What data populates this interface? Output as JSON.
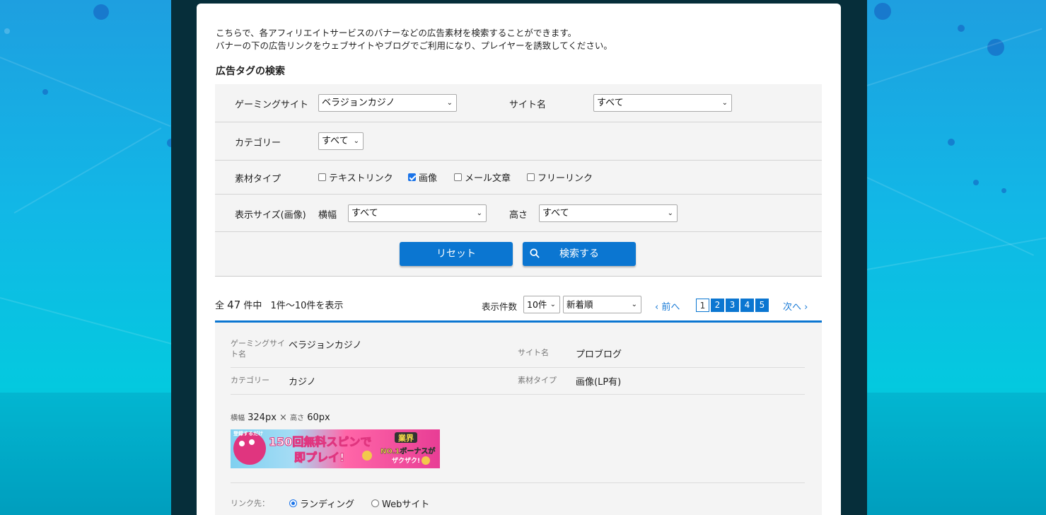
{
  "intro": {
    "line1": "こちらで、各アフィリエイトサービスのバナーなどの広告素材を検索することができます。",
    "line2": "バナーの下の広告リンクをウェブサイトやブログでご利用になり、プレイヤーを誘致してください。"
  },
  "search": {
    "title": "広告タグの検索",
    "gaming_site_label": "ゲーミングサイト",
    "gaming_site_value": "ベラジョンカジノ",
    "site_name_label": "サイト名",
    "site_name_value": "すべて",
    "category_label": "カテゴリー",
    "category_value": "すべて",
    "material_type_label": "素材タイプ",
    "material_types": [
      {
        "label": "テキストリンク",
        "checked": false
      },
      {
        "label": "画像",
        "checked": true
      },
      {
        "label": "メール文章",
        "checked": false
      },
      {
        "label": "フリーリンク",
        "checked": false
      }
    ],
    "display_size_label": "表示サイズ(画像)",
    "width_label": "横幅",
    "width_value": "すべて",
    "height_label": "高さ",
    "height_value": "すべて",
    "reset_label": "リセット",
    "search_label": "検索する"
  },
  "results": {
    "prefix": "全",
    "total": "47",
    "suffix": "件中",
    "range": "1件～10件を表示",
    "per_page_label": "表示件数",
    "per_page_value": "10件",
    "sort_value": "新着順",
    "prev_label": "前へ",
    "next_label": "次へ",
    "pages": [
      "1",
      "2",
      "3",
      "4",
      "5"
    ],
    "current_page": "1"
  },
  "item": {
    "gaming_site_label": "ゲーミングサイト名",
    "gaming_site_value": "ベラジョンカジノ",
    "site_name_label": "サイト名",
    "site_name_value": "プロブログ",
    "category_label": "カテゴリー",
    "category_value": "カジノ",
    "material_type_label": "素材タイプ",
    "material_type_value": "画像(LP有)",
    "width_label": "横幅",
    "width_value": "324px",
    "times": "×",
    "height_label": "高さ",
    "height_value": "60px",
    "banner": {
      "small_text": "登録するだけ",
      "main_text": "150回無料スピンで",
      "main_text2": "即プレイ!",
      "badge1": "業界",
      "badge2": "NO.1ボーナスが",
      "badge3": "ザクザク!"
    },
    "link_label": "リンク先：",
    "link_options": [
      {
        "label": "ランディング",
        "selected": true
      },
      {
        "label": "Webサイト",
        "selected": false
      }
    ]
  },
  "colors": {
    "accent": "#0b76d1",
    "frame": "#062e3a",
    "panel": "#f4f4f4"
  }
}
